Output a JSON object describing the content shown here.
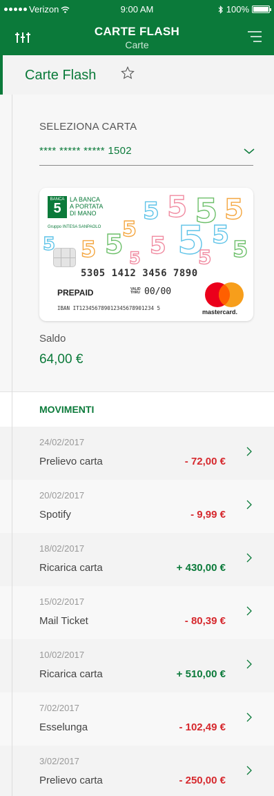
{
  "status_bar": {
    "carrier": "Verizon",
    "time": "9:00 AM",
    "battery": "100%"
  },
  "header": {
    "title": "CARTE FLASH",
    "subtitle": "Carte"
  },
  "page": {
    "title": "Carte Flash"
  },
  "card_select": {
    "label": "SELEZIONA CARTA",
    "value": "**** ***** ***** 1502"
  },
  "card": {
    "bank_badge": "BANCA",
    "bank_number": "5",
    "tagline_1": "LA BANCA",
    "tagline_2": "A PORTATA",
    "tagline_3": "DI MANO",
    "group": "Gruppo INTESA SANPAOLO",
    "number": "5305 1412 3456 7890",
    "type": "PREPAID",
    "valid_1": "VALID",
    "valid_2": "THRU",
    "expiry": "00/00",
    "iban": "IBAN IT123456789012345678901234 5",
    "brand": "mastercard."
  },
  "balance": {
    "label": "Saldo",
    "value": "64,00 €"
  },
  "movements": {
    "title": "MOVIMENTI",
    "items": [
      {
        "date": "24/02/2017",
        "desc": "Prelievo carta",
        "amount": "- 72,00 €",
        "sign": "neg"
      },
      {
        "date": "20/02/2017",
        "desc": "Spotify",
        "amount": "- 9,99 €",
        "sign": "neg"
      },
      {
        "date": "18/02/2017",
        "desc": "Ricarica carta",
        "amount": "+ 430,00 €",
        "sign": "pos"
      },
      {
        "date": "15/02/2017",
        "desc": "Mail Ticket",
        "amount": "- 80,39 €",
        "sign": "neg"
      },
      {
        "date": "10/02/2017",
        "desc": "Ricarica carta",
        "amount": "+ 510,00 €",
        "sign": "pos"
      },
      {
        "date": "7/02/2017",
        "desc": "Esselunga",
        "amount": "- 102,49 €",
        "sign": "neg"
      },
      {
        "date": "3/02/2017",
        "desc": "Prelievo carta",
        "amount": "- 250,00 €",
        "sign": "neg"
      }
    ]
  },
  "colors": {
    "brand_green": "#0b7a3a",
    "negative_red": "#d6282d"
  },
  "icons": {
    "filter": "sliders-icon",
    "menu": "hamburger-icon",
    "favorite": "star-outline-icon",
    "dropdown": "chevron-down-icon",
    "row": "chevron-right-icon"
  }
}
